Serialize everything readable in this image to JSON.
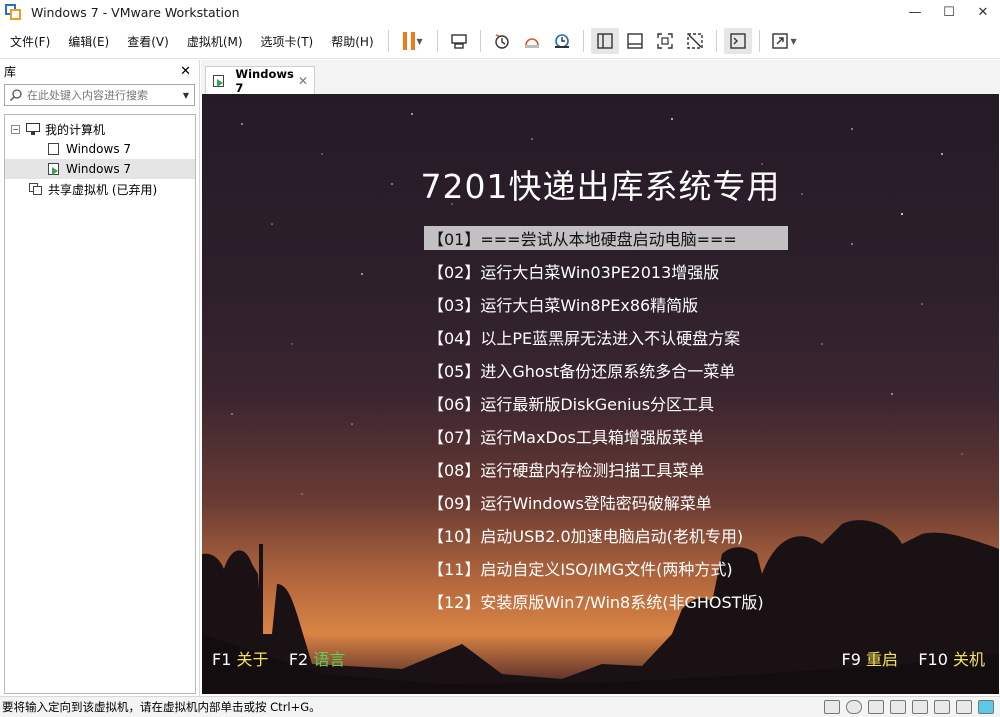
{
  "window": {
    "title": "Windows 7 - VMware Workstation",
    "controls": {
      "minimize": "—",
      "maximize": "☐",
      "close": "✕"
    }
  },
  "menu": [
    {
      "label": "文件(F)"
    },
    {
      "label": "编辑(E)"
    },
    {
      "label": "查看(V)"
    },
    {
      "label": "虚拟机(M)"
    },
    {
      "label": "选项卡(T)"
    },
    {
      "label": "帮助(H)"
    }
  ],
  "toolbar": {
    "pause_color": "#ef7a1a",
    "icons": [
      "pause-icon",
      "send-ctrl-alt-del-icon",
      "snapshot-icon",
      "revert-snapshot-icon",
      "snapshot-manager-icon",
      "library-view-icon",
      "thumbnail-view-icon",
      "fullscreen-icon",
      "unity-icon",
      "console-icon",
      "stretch-icon"
    ]
  },
  "library": {
    "title": "库",
    "close": "✕",
    "search_placeholder": "在此处键入内容进行搜索",
    "tree": [
      {
        "label": "我的计算机",
        "expander": "−"
      },
      {
        "label": "Windows 7"
      },
      {
        "label": "Windows 7",
        "selected": true
      },
      {
        "label": "共享虚拟机 (已弃用)"
      }
    ]
  },
  "tab": {
    "label": "Windows 7",
    "close": "✕"
  },
  "vm": {
    "title": "7201快递出库系统专用",
    "items": [
      "【01】===尝试从本地硬盘启动电脑===",
      "【02】运行大白菜Win03PE2013增强版",
      "【03】运行大白菜Win8PEx86精简版",
      "【04】以上PE蓝黑屏无法进入不认硬盘方案",
      "【05】进入Ghost备份还原系统多合一菜单",
      "【06】运行最新版DiskGenius分区工具",
      "【07】运行MaxDos工具箱增强版菜单",
      "【08】运行硬盘内存检测扫描工具菜单",
      "【09】运行Windows登陆密码破解菜单",
      "【10】启动USB2.0加速电脑启动(老机专用)",
      "【11】启动自定义ISO/IMG文件(两种方式)",
      "【12】安装原版Win7/Win8系统(非GHOST版)"
    ],
    "selected_index": 0,
    "fkeys": {
      "f1_key": "F1",
      "f1_label": "关于",
      "f2_key": "F2",
      "f2_label": "语言",
      "f9_key": "F9",
      "f9_label": "重启",
      "f10_key": "F10",
      "f10_label": "关机"
    }
  },
  "status": {
    "text": "要将输入定向到该虚拟机，请在虚拟机内部单击或按 Ctrl+G。"
  }
}
